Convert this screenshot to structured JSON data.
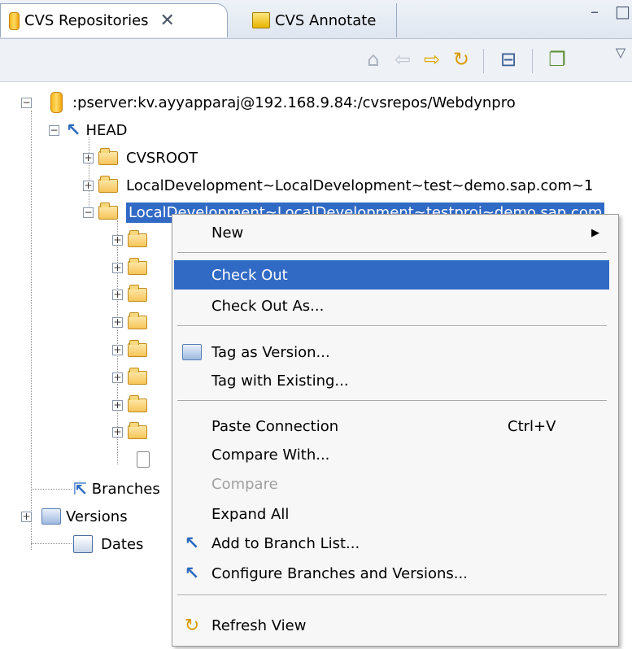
{
  "tabs": {
    "repositories": {
      "label": "CVS Repositories",
      "close": "✕"
    },
    "annotate": {
      "label": "CVS Annotate"
    }
  },
  "view_controls": {
    "minimize": "–",
    "maximize": "□"
  },
  "toolbar": {
    "home": "⌂",
    "back": "⇦",
    "forward": "⇨",
    "refresh": "↻",
    "collapse": "⊟",
    "new_location": "❐",
    "menu": "▽"
  },
  "tree": {
    "repository": ":pserver:kv.ayyapparaj@192.168.9.84:/cvsrepos/Webdynpro",
    "head": "HEAD",
    "folders": [
      "CVSROOT",
      "LocalDevelopment~LocalDevelopment~test~demo.sap.com~1",
      "LocalDevelopment~LocalDevelopment~testproj~demo.sap.com"
    ],
    "branches": "Branches",
    "versions": "Versions",
    "dates": "Dates"
  },
  "context_menu": {
    "new": "New",
    "check_out": "Check Out",
    "check_out_as": "Check Out As...",
    "tag_as_version": "Tag as Version...",
    "tag_with_existing": "Tag with Existing...",
    "paste_connection": "Paste Connection",
    "paste_shortcut": "Ctrl+V",
    "compare_with": "Compare With...",
    "compare": "Compare",
    "expand_all": "Expand All",
    "add_to_branch_list": "Add to Branch List...",
    "configure_branches": "Configure Branches and Versions...",
    "refresh_view": "Refresh View"
  },
  "colors": {
    "selection": "#316ac5",
    "folder": "#f6c55a",
    "repo": "#f7b719"
  }
}
